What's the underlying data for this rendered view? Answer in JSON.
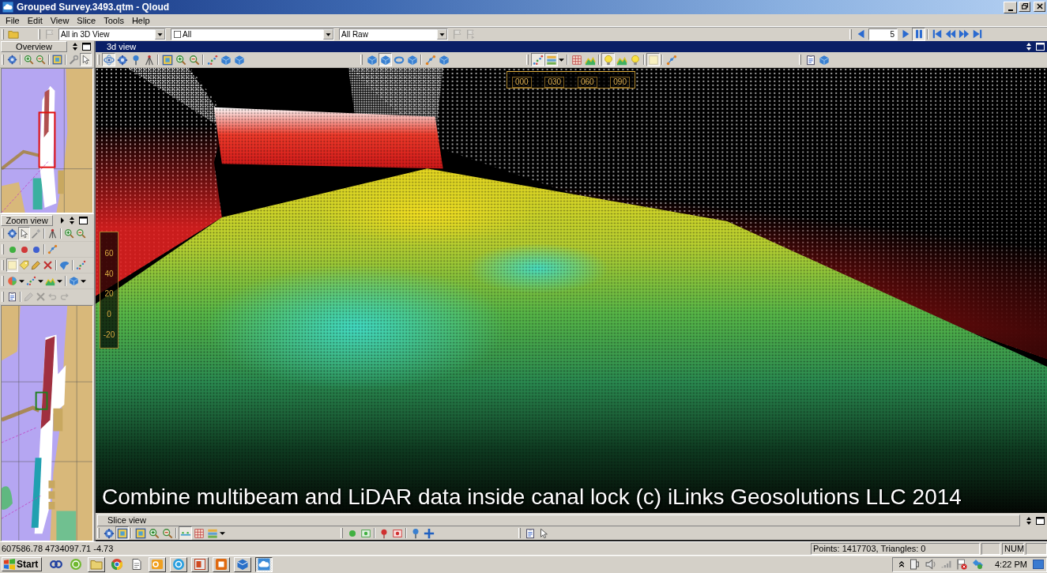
{
  "window": {
    "title": "Grouped Survey.3493.qtm - Qloud"
  },
  "menu": [
    "File",
    "Edit",
    "View",
    "Slice",
    "Tools",
    "Help"
  ],
  "main_toolbar": {
    "buttons": [
      {
        "disabled": false
      },
      {
        "disabled": true
      },
      {
        "disabled": true
      },
      {
        "disabled": true
      }
    ],
    "dropdowns": [
      {
        "value": "All in 3D View"
      },
      {
        "value": "All"
      },
      {
        "value": "All Raw"
      }
    ]
  },
  "playback": {
    "frame": "5",
    "buttons": [
      {
        "pressed": false
      },
      {
        "pressed": false
      },
      {
        "pressed": true
      },
      {
        "pressed": false
      },
      {
        "pressed": false
      },
      {
        "pressed": false
      },
      {
        "pressed": false
      }
    ]
  },
  "overview": {
    "title": "Overview",
    "toolbar": [
      {
        "pressed": false
      },
      {
        "pressed": false
      },
      {
        "pressed": false
      },
      {
        "pressed": false
      },
      {
        "pressed": false
      },
      {
        "pressed": true
      }
    ]
  },
  "zoom_view": {
    "title": "Zoom view",
    "toolbar_rows": [
      [
        {
          "pressed": false,
          "disabled": false
        },
        {
          "pressed": true,
          "disabled": false
        },
        {
          "pressed": false,
          "disabled": false
        },
        {
          "pressed": false,
          "disabled": false
        },
        {
          "pressed": false,
          "disabled": false
        },
        {
          "pressed": false,
          "disabled": false
        }
      ],
      [
        {
          "pressed": false,
          "disabled": false
        },
        {
          "pressed": false,
          "disabled": false
        },
        {
          "pressed": false,
          "disabled": false
        },
        {
          "pressed": false,
          "disabled": false
        }
      ],
      [
        {
          "pressed": true,
          "disabled": false
        },
        {
          "pressed": false,
          "disabled": false
        },
        {
          "pressed": false,
          "disabled": false
        },
        {
          "pressed": false,
          "disabled": false
        },
        {
          "pressed": false,
          "disabled": false
        },
        {
          "pressed": false,
          "disabled": false
        }
      ],
      [
        {
          "pressed": false,
          "disabled": false
        },
        {
          "pressed": false,
          "disabled": false
        },
        {
          "pressed": false,
          "disabled": false
        },
        {
          "pressed": false,
          "disabled": false
        },
        {
          "pressed": false,
          "disabled": false
        },
        {
          "pressed": false,
          "disabled": false
        },
        {
          "pressed": false,
          "disabled": false
        },
        {
          "pressed": false,
          "disabled": false
        }
      ],
      [
        {
          "pressed": false,
          "disabled": false
        },
        {
          "pressed": false,
          "disabled": true
        },
        {
          "pressed": false,
          "disabled": true
        },
        {
          "pressed": false,
          "disabled": true
        },
        {
          "pressed": false,
          "disabled": true
        }
      ]
    ]
  },
  "view_3d": {
    "title": "3d view",
    "toolbar": [
      {
        "pressed": true
      },
      {
        "pressed": false
      },
      {
        "pressed": false
      },
      {
        "pressed": false
      },
      {
        "pressed": false
      },
      {
        "pressed": false
      },
      {
        "pressed": false
      },
      {
        "pressed": false
      },
      {
        "pressed": false
      },
      {
        "pressed": false
      },
      {
        "pressed": false
      },
      {
        "pressed": true
      },
      {
        "pressed": false
      },
      {
        "pressed": false
      },
      {
        "pressed": false
      },
      {
        "pressed": false
      },
      {
        "pressed": true
      },
      {
        "pressed": true
      },
      {
        "pressed": false
      },
      {
        "pressed": false
      },
      {
        "pressed": false
      },
      {
        "pressed": true
      },
      {
        "pressed": false
      },
      {
        "pressed": false
      },
      {
        "pressed": true
      },
      {
        "pressed": false
      },
      {
        "pressed": false
      },
      {
        "pressed": false
      }
    ],
    "heading_scale": [
      "000",
      "030",
      "060",
      "090"
    ],
    "depth_scale": [
      "60",
      "40",
      "20",
      "0",
      "-20"
    ],
    "caption": "Combine multibeam and LiDAR data inside canal lock (c) iLinks Geosolutions LLC 2014"
  },
  "slice_view": {
    "title": "Slice view",
    "toolbar": [
      {
        "pressed": false
      },
      {
        "pressed": true
      },
      {
        "pressed": false
      },
      {
        "pressed": false
      },
      {
        "pressed": false
      },
      {
        "pressed": true
      },
      {
        "pressed": false
      },
      {
        "pressed": false
      },
      {
        "pressed": false
      },
      {
        "pressed": false
      },
      {
        "pressed": false
      },
      {
        "pressed": false
      },
      {
        "pressed": false
      },
      {
        "pressed": false
      },
      {
        "pressed": false
      },
      {
        "pressed": false
      },
      {
        "pressed": false
      }
    ]
  },
  "status_bar": {
    "coordinates": "607586.78 4734097.71 -4.73",
    "counts": "Points: 1417703, Triangles: 0",
    "indicator": "NUM"
  },
  "taskbar": {
    "start": "Start",
    "items": [
      {
        "kind": "launcher",
        "selected": false
      },
      {
        "kind": "launcher",
        "selected": false
      },
      {
        "kind": "window",
        "selected": false
      },
      {
        "kind": "launcher",
        "selected": false
      },
      {
        "kind": "launcher",
        "selected": false
      },
      {
        "kind": "window",
        "selected": false
      },
      {
        "kind": "window",
        "selected": false
      },
      {
        "kind": "window",
        "selected": false
      },
      {
        "kind": "window",
        "selected": false
      },
      {
        "kind": "window",
        "selected": false
      },
      {
        "kind": "window",
        "selected": true
      }
    ],
    "clock": "4:22 PM"
  }
}
